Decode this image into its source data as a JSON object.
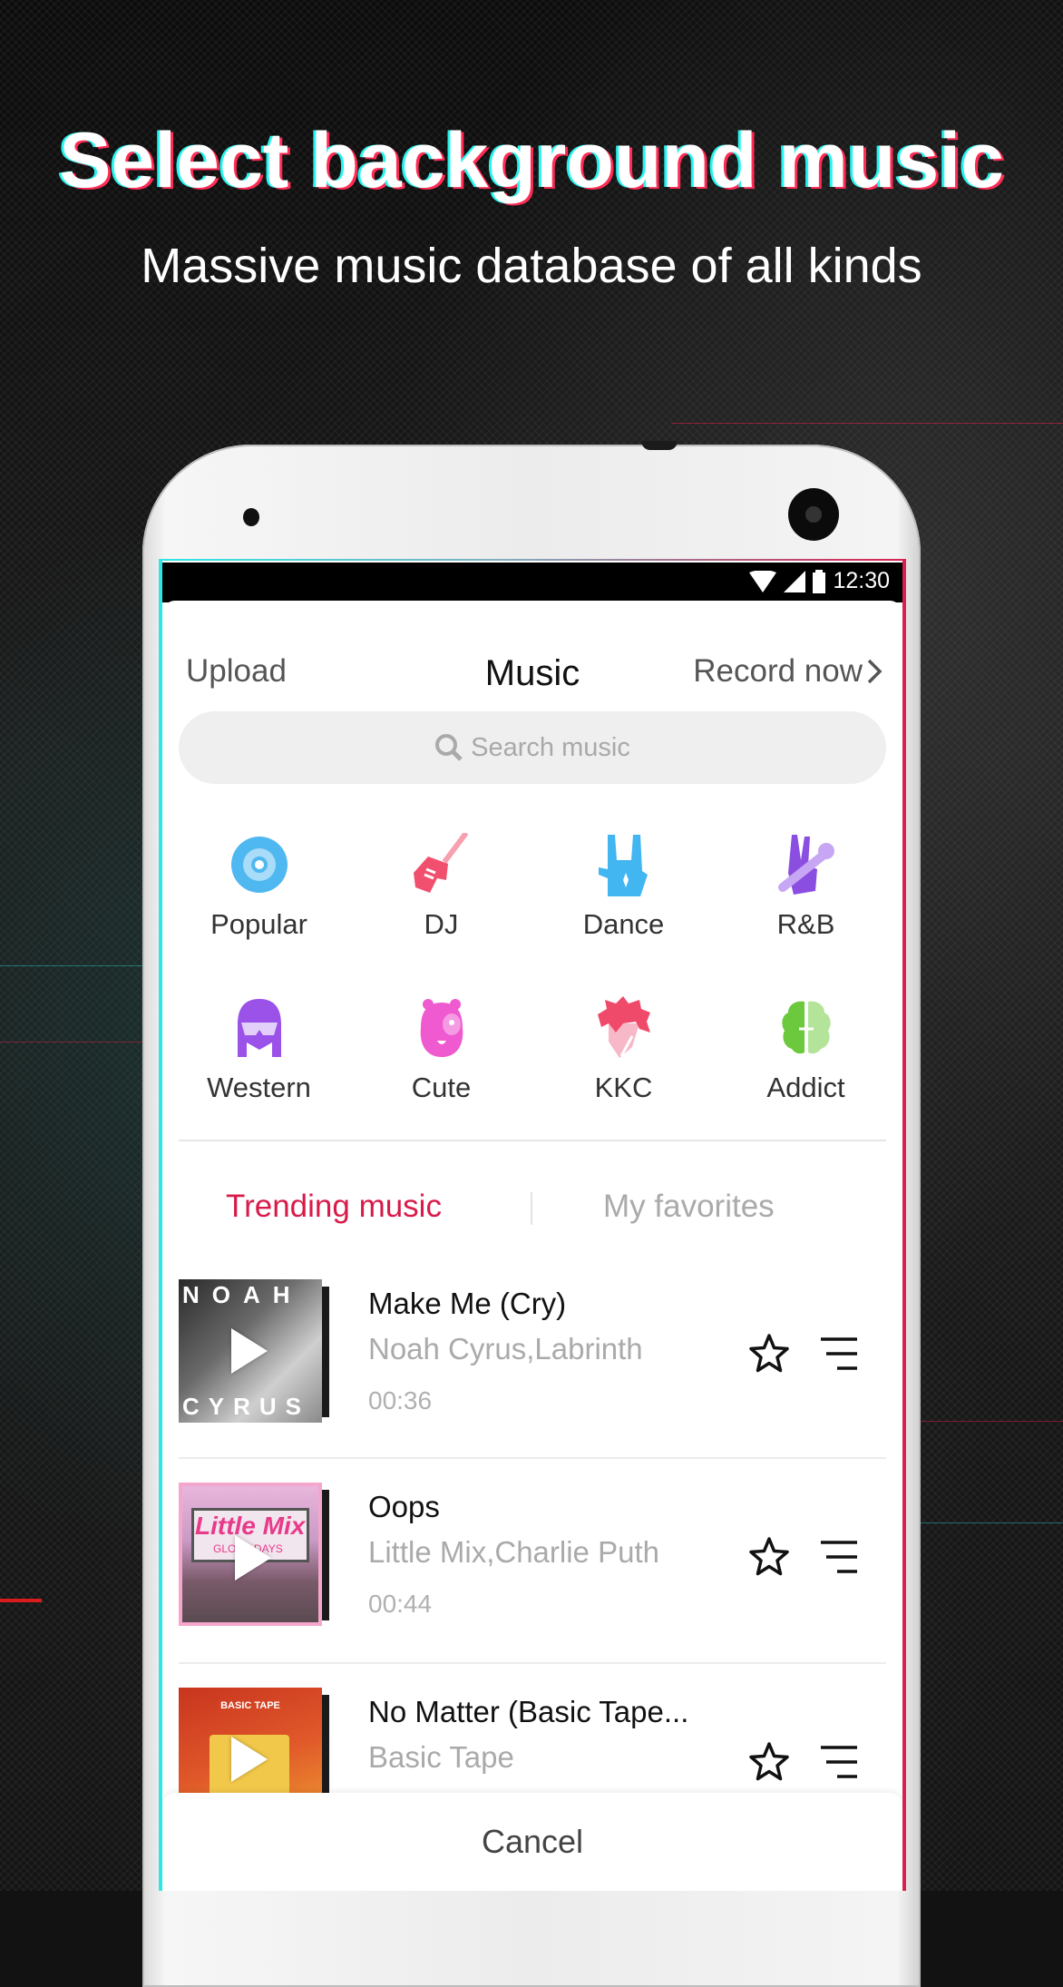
{
  "promo": {
    "headline": "Select background music",
    "subline": "Massive music database of all kinds"
  },
  "status_bar": {
    "time": "12:30",
    "icons": [
      "wifi-icon",
      "signal-icon",
      "battery-icon"
    ]
  },
  "header": {
    "upload_label": "Upload",
    "title": "Music",
    "record_label": "Record now"
  },
  "search": {
    "placeholder": "Search music"
  },
  "categories": [
    {
      "label": "Popular",
      "icon": "vinyl-disc-icon",
      "color": "#4fb8f0"
    },
    {
      "label": "DJ",
      "icon": "guitar-icon",
      "color": "#f0506e"
    },
    {
      "label": "Dance",
      "icon": "rock-hand-icon",
      "color": "#42b6f0"
    },
    {
      "label": "R&B",
      "icon": "peace-hand-mic-icon",
      "color": "#8a4fe0"
    },
    {
      "label": "Western",
      "icon": "sunglasses-girl-icon",
      "color": "#9a52e8"
    },
    {
      "label": "Cute",
      "icon": "hippo-icon",
      "color": "#f05ad0"
    },
    {
      "label": "KKC",
      "icon": "spiky-hair-icon",
      "color": "#f04a6a"
    },
    {
      "label": "Addict",
      "icon": "brain-icon",
      "color": "#6cc83c"
    }
  ],
  "tabs": {
    "active": "Trending music",
    "inactive": "My favorites",
    "accent_color": "#d81b4a"
  },
  "tracks": [
    {
      "title": "Make Me (Cry)",
      "artist": "Noah Cyrus,Labrinth",
      "duration": "00:36",
      "cover_text_top": "NOAH",
      "cover_text_bottom": "CYRUS"
    },
    {
      "title": "Oops",
      "artist": "Little Mix,Charlie Puth",
      "duration": "00:44",
      "cover_text_top": "Little Mix",
      "cover_text_bottom": "GLORY DAYS"
    },
    {
      "title": "No Matter (Basic Tape...",
      "artist": "Basic Tape",
      "duration": "",
      "cover_text_top": "BASIC TAPE",
      "cover_text_bottom": ""
    }
  ],
  "cancel_label": "Cancel"
}
